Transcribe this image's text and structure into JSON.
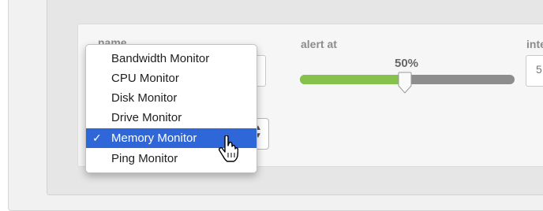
{
  "form": {
    "name_label": "name",
    "alert_label": "alert at",
    "interval_label": "inte",
    "interval_value": "5",
    "alert_value": "50%",
    "alert_fraction": 0.5
  },
  "dropdown": {
    "items": [
      {
        "label": "Bandwidth Monitor",
        "selected": false
      },
      {
        "label": "CPU Monitor",
        "selected": false
      },
      {
        "label": "Disk Monitor",
        "selected": false
      },
      {
        "label": "Drive Monitor",
        "selected": false
      },
      {
        "label": "Memory Monitor",
        "selected": true
      },
      {
        "label": "Ping Monitor",
        "selected": false
      }
    ],
    "check_mark": "✓"
  },
  "colors": {
    "slider_fill": "#86c24b",
    "selection": "#2f67d9"
  }
}
